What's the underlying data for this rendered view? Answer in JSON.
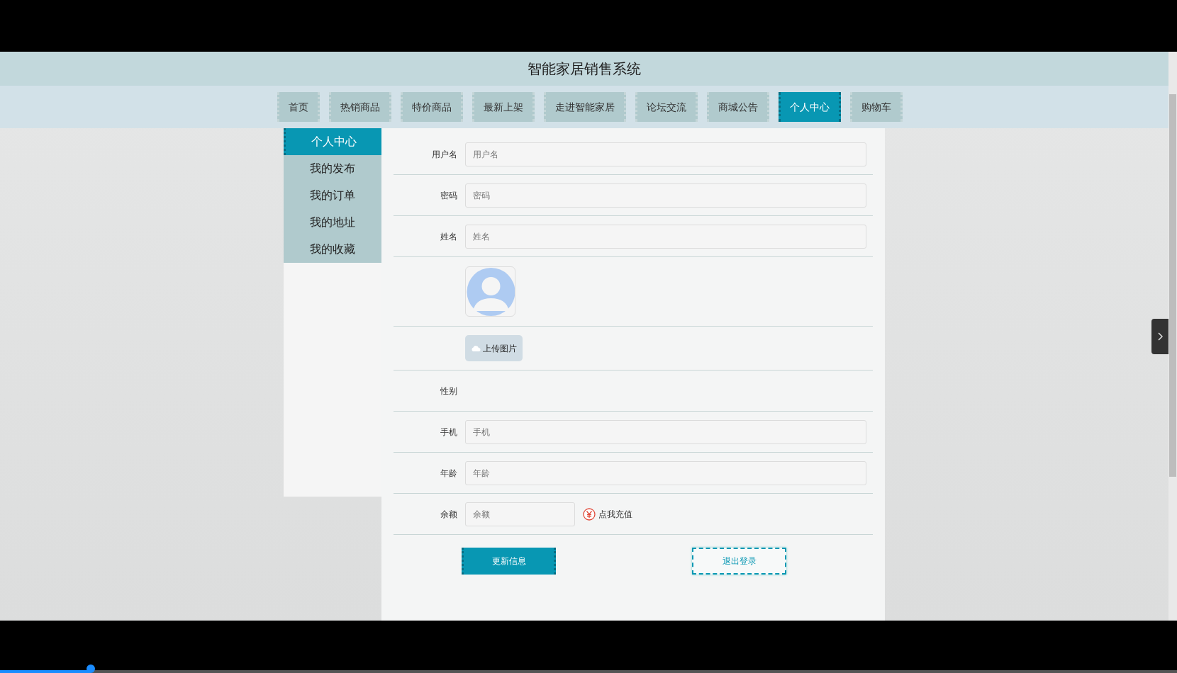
{
  "site_title": "智能家居销售系统",
  "nav": [
    {
      "label": "首页",
      "selected": false
    },
    {
      "label": "热销商品",
      "selected": false
    },
    {
      "label": "特价商品",
      "selected": false
    },
    {
      "label": "最新上架",
      "selected": false
    },
    {
      "label": "走进智能家居",
      "selected": false
    },
    {
      "label": "论坛交流",
      "selected": false
    },
    {
      "label": "商城公告",
      "selected": false
    },
    {
      "label": "个人中心",
      "selected": true
    },
    {
      "label": "购物车",
      "selected": false
    }
  ],
  "sidebar": {
    "items": [
      {
        "label": "个人中心",
        "selected": true
      },
      {
        "label": "我的发布",
        "selected": false
      },
      {
        "label": "我的订单",
        "selected": false
      },
      {
        "label": "我的地址",
        "selected": false
      },
      {
        "label": "我的收藏",
        "selected": false
      }
    ]
  },
  "form": {
    "fields": [
      {
        "kind": "input",
        "label": "用户名",
        "placeholder": "用户名"
      },
      {
        "kind": "input",
        "label": "密码",
        "placeholder": "密码"
      },
      {
        "kind": "input",
        "label": "姓名",
        "placeholder": "姓名"
      },
      {
        "kind": "avatar"
      },
      {
        "kind": "upload",
        "button": "上传图片"
      },
      {
        "kind": "text",
        "label": "性别"
      },
      {
        "kind": "input",
        "label": "手机",
        "placeholder": "手机"
      },
      {
        "kind": "input",
        "label": "年龄",
        "placeholder": "年龄"
      },
      {
        "kind": "balance",
        "label": "余额",
        "placeholder": "余额",
        "link": "点我充值"
      }
    ],
    "buttons": [
      {
        "kind": "primary",
        "label": "更新信息"
      },
      {
        "kind": "outline",
        "label": "退出登录"
      }
    ]
  },
  "video_progress": {
    "level": 0.077
  }
}
